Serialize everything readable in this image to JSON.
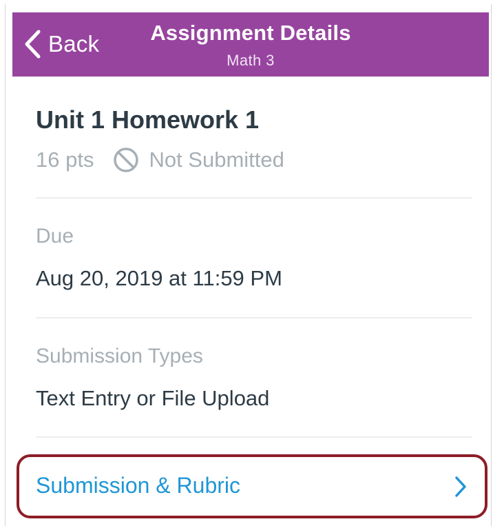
{
  "header": {
    "back_label": "Back",
    "title": "Assignment Details",
    "subtitle": "Math 3",
    "background_color": "#97449f"
  },
  "assignment": {
    "title": "Unit 1 Homework 1",
    "points": "16 pts",
    "status": "Not Submitted",
    "status_icon": "not-submitted-icon"
  },
  "due": {
    "label": "Due",
    "value": "Aug 20, 2019 at 11:59 PM"
  },
  "submission_types": {
    "label": "Submission Types",
    "value": "Text Entry or File Upload"
  },
  "submission_link": {
    "label": "Submission & Rubric",
    "icon": "chevron-right-icon",
    "link_color": "#1f96d6",
    "highlight_color": "#8d1d27"
  }
}
